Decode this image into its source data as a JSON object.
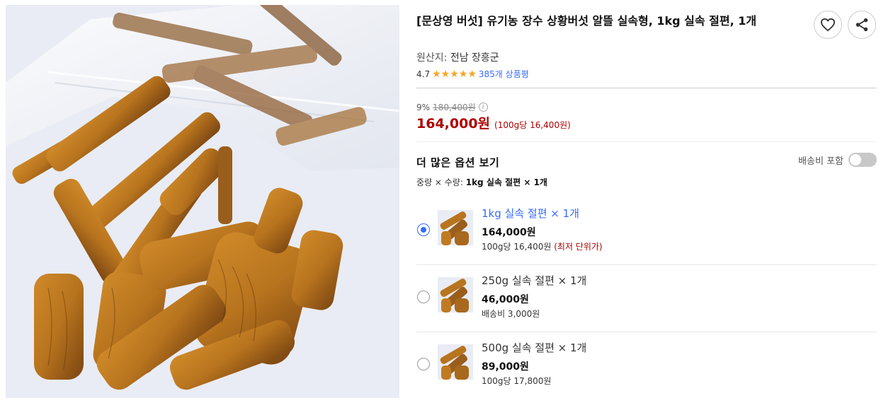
{
  "product": {
    "title": "[문상영 버섯] 유기농 장수 상황버섯 알뜰 실속형, 1kg 실속 절편, 1개",
    "image_alt": "dried sanghwang mushroom slices in a plastic bag",
    "origin_label": "원산지:",
    "origin_value": "전남 장흥군",
    "rating_score": "4.7",
    "rating_stars": 5,
    "review_count": "385개 상품평",
    "icons": {
      "favorite": "heart-icon",
      "share": "share-icon",
      "info": "info-icon"
    }
  },
  "pricing": {
    "discount": "9%",
    "original_price": "180,400원",
    "sale_price": "164,000원",
    "unit_price": "(100g당 16,400원)"
  },
  "options": {
    "more_label": "더 많은 옵션 보기",
    "shipping_toggle_label": "배송비 포함",
    "shipping_toggle_on": false,
    "summary_label": "중량 × 수량:",
    "summary_value": "1kg 실속 절편 × 1개",
    "items": [
      {
        "name": "1kg 실속 절편 × 1개",
        "price": "164,000원",
        "sub": "100g당 16,400원",
        "sub_note": "(최저 단위가)",
        "selected": true
      },
      {
        "name": "250g 실속 절편 × 1개",
        "price": "46,000원",
        "sub": "배송비 3,000원",
        "sub_note": "",
        "selected": false
      },
      {
        "name": "500g 실속 절편 × 1개",
        "price": "89,000원",
        "sub": "100g당 17,800원",
        "sub_note": "",
        "selected": false
      }
    ]
  },
  "colors": {
    "accent_blue": "#346aff",
    "price_red": "#ae0000",
    "star": "#f5a623",
    "mushroom": "#b8741e"
  }
}
